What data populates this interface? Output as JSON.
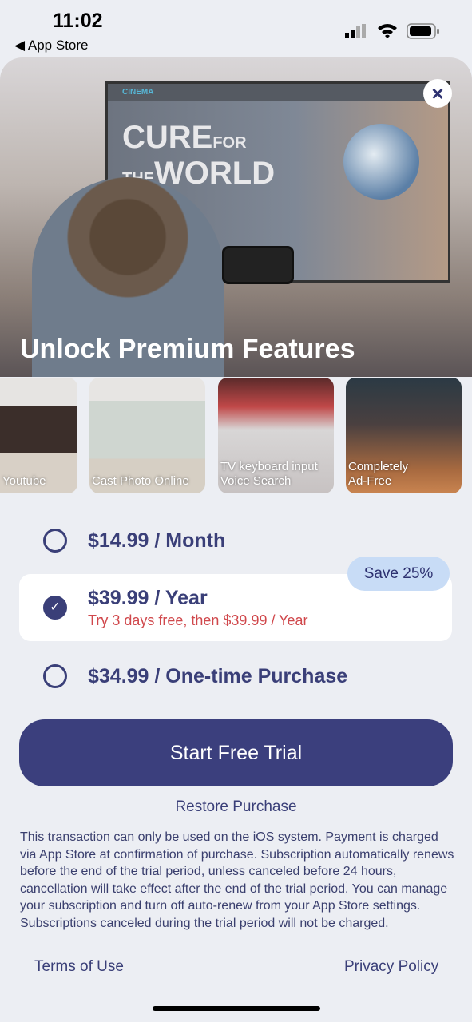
{
  "status_bar": {
    "time": "11:02",
    "back_label": "◀ App Store"
  },
  "hero": {
    "tv_brand": "CINEMA",
    "tv_title_1": "CURE",
    "tv_title_2": "FOR",
    "tv_title_3": "THE",
    "tv_title_4": "WORLD",
    "title": "Unlock Premium Features",
    "close_icon": "×"
  },
  "features": [
    {
      "label": "Youtube",
      "bg": "linear-gradient(180deg,#e6e4e2 0 25%,#3b2e2a 25% 65%,#d8d0c6 65%)"
    },
    {
      "label": "Cast Photo Online",
      "bg": "linear-gradient(180deg,#e7e5e3 0 20%,#cfd6d0 20% 70%,#d6cfc4 70%)"
    },
    {
      "label": "TV keyboard input\nVoice Search",
      "bg": "linear-gradient(180deg,#5a2a2a 0,#c04848 25%,#d8d6d6 45%,#c7c2c2)"
    },
    {
      "label": "Completely\nAd-Free",
      "bg": "linear-gradient(180deg,#2b3a44 0,#4a4040 40%,#a86a40 80%,#c98450)"
    }
  ],
  "plans": [
    {
      "label": "$14.99 / Month",
      "selected": false
    },
    {
      "label": "$39.99 / Year",
      "sub": "Try 3 days free, then $39.99 / Year",
      "selected": true,
      "badge": "Save 25%"
    },
    {
      "label": "$34.99 / One-time Purchase",
      "selected": false
    }
  ],
  "check_icon": "✓",
  "cta": "Start Free Trial",
  "restore": "Restore Purchase",
  "legal": "This transaction can only be used on the iOS system. Payment is charged via App Store at confirmation of purchase. Subscription automatically renews before the end of the trial period, unless canceled before 24 hours, cancellation will take effect after the end of the trial period. You can manage your subscription and turn off auto-renew from your App Store settings. Subscriptions canceled during the trial period will not be charged.",
  "links": {
    "terms": "Terms of Use",
    "privacy": "Privacy Policy"
  },
  "colors": {
    "accent": "#3b3f7d",
    "trial_text": "#d0484c",
    "badge": "#c8dcf6"
  }
}
